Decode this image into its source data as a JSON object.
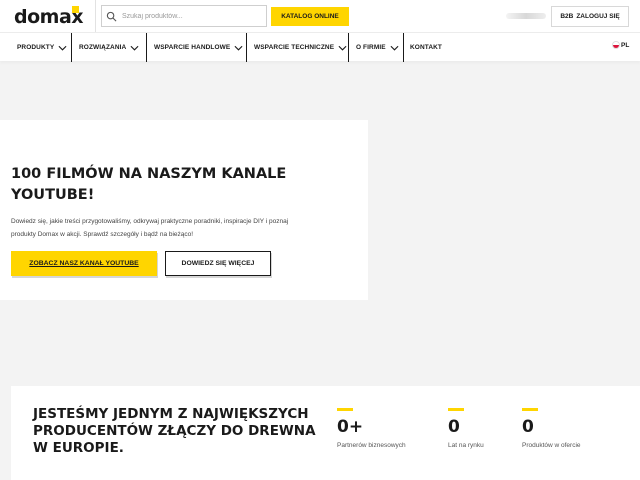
{
  "header": {
    "logo_text": "domax",
    "search": {
      "placeholder": "Szukaj produktów..."
    },
    "catalog_button": "KATALOG ONLINE",
    "b2b_badge": "B2B",
    "login_button": "ZALOGUJ SIĘ"
  },
  "nav": {
    "items": [
      {
        "label": "PRODUKTY",
        "dropdown": true
      },
      {
        "label": "ROZWIĄZANIA",
        "dropdown": true
      },
      {
        "label": "WSPARCIE HANDLOWE",
        "dropdown": true
      },
      {
        "label": "WSPARCIE TECHNICZNE",
        "dropdown": true
      },
      {
        "label": "O FIRMIE",
        "dropdown": true
      },
      {
        "label": "KONTAKT",
        "dropdown": false
      }
    ],
    "language": "PL"
  },
  "promo": {
    "title": "100 FILMÓW NA NASZYM KANALE YOUTUBE!",
    "description": "Dowiedz się, jakie treści przygotowaliśmy, odkrywaj praktyczne poradniki, inspiracje DIY i poznaj produkty Domax w akcji. Sprawdź szczegóły i bądź na bieżąco!",
    "primary_button": "ZOBACZ NASZ KANAŁ YOUTUBE",
    "secondary_button": "DOWIEDZ SIĘ WIĘCEJ"
  },
  "stats": {
    "heading": "JESTEŚMY JEDNYM Z NAJWIĘKSZYCH PRODUCENTÓW ZŁĄCZY DO DREWNA W EUROPIE.",
    "items": [
      {
        "value": "0+",
        "label": "Partnerów biznesowych"
      },
      {
        "value": "0",
        "label": "Lat na rynku"
      },
      {
        "value": "0",
        "label": "Produktów w ofercie"
      }
    ]
  },
  "colors": {
    "accent": "#ffd500",
    "text": "#1a1a1a",
    "background": "#f3f3f3"
  }
}
